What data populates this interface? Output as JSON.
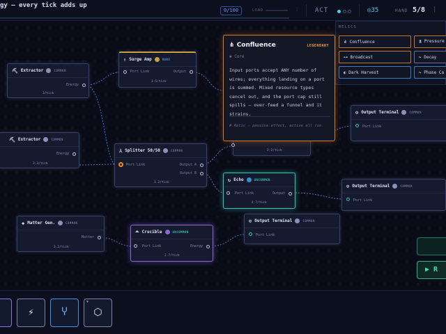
{
  "header": {
    "title": "gy — every tick adds up",
    "load_value": "0/100",
    "load_label": "LOAD",
    "act_label": "ACT",
    "coin_value": "◎35",
    "hand_label": "HAND",
    "hand_value": "5/8",
    "load_sep": "⁞",
    "hand_sep": "|"
  },
  "nodes": {
    "extractor1": {
      "title": "Extractor",
      "rarity": "COMMON",
      "port_out": "Energy",
      "rate": "3/tick"
    },
    "extractor2": {
      "title": "Extractor",
      "rarity": "COMMON",
      "port_out": "Energy",
      "rate": "3.3/tick"
    },
    "surge_amp": {
      "title": "Surge Amp",
      "rarity": "RARE",
      "port_in": "Port Link",
      "port_out": "Output",
      "rate": "3.5/tick"
    },
    "splitter": {
      "title": "Splitter 50/50",
      "rarity": "COMMON",
      "port_in": "Port Link",
      "port_out_a": "Output A",
      "port_out_b": "Output B",
      "rate": "1.2/tick"
    },
    "echo": {
      "title": "Echo",
      "rarity": "UNCOMMON",
      "port_in": "Port Link",
      "port_out": "Output",
      "rate": "4.7/tick"
    },
    "hidden_rate": {
      "rate": "2.2/tick"
    },
    "output1": {
      "title": "Output Terminal",
      "rarity": "COMMON",
      "port_in": "Port Link"
    },
    "output2": {
      "title": "Output Terminal",
      "rarity": "COMMON",
      "port_in": "Port Link"
    },
    "output3": {
      "title": "Output Terminal",
      "rarity": "COMMON",
      "port_in": "Port Link"
    },
    "matter_gen": {
      "title": "Matter Gen.",
      "rarity": "COMMON",
      "port_out": "Matter",
      "rate": "3.2/tick"
    },
    "crucible": {
      "title": "Crucible",
      "rarity": "UNCOMMON",
      "port_in": "Port Link",
      "port_out": "Energy",
      "rate": "2.7/tick"
    }
  },
  "tooltip": {
    "title": "Confluence",
    "rarity": "LEGENDARY",
    "type": "✱ Core",
    "description": "Input ports accept ANY number of wires; everything landing on a port is summed. Mixed resource types cancel out, and the port cap still spills — over-feed a funnel and it strains.",
    "note": "# Relic — passive effect, active all run"
  },
  "relics": {
    "label": "RELICS",
    "items": [
      {
        "label": "⋔ Confluence",
        "color": "#c9772a"
      },
      {
        "label": "⧗ Pressure V",
        "color": "#c9772a"
      },
      {
        "label": "⊶ Broadcast",
        "color": "#c9772a"
      },
      {
        "label": "↪ Decay",
        "color": "#6a6fa0"
      },
      {
        "label": "◐ Dark Harvest",
        "color": "#3c7bbf"
      },
      {
        "label": "↪ Phase Ca",
        "color": "#3c7bbf"
      }
    ]
  },
  "hand": {
    "cards": [
      {
        "symbol": "",
        "corner": "",
        "border": "#8a7ae0"
      },
      {
        "symbol": "⚡",
        "corner": "",
        "border": "#8a90b8"
      },
      {
        "symbol": "Ⴤ",
        "corner": "",
        "border": "#4a8fe0"
      },
      {
        "symbol": "⬡",
        "corner": "▼",
        "border": "#8a90b8"
      }
    ]
  },
  "side_buttons": [
    {
      "label": "",
      "variant": "plain"
    },
    {
      "label": "▶ R",
      "variant": "run"
    }
  ],
  "colors": {
    "background": "#0a0c17",
    "accent_cyan": "#46d3e8",
    "accent_orange": "#d27a2a",
    "accent_purple": "#8a64d8",
    "accent_teal": "#2fc7b2",
    "wire": "#4e74c8"
  }
}
